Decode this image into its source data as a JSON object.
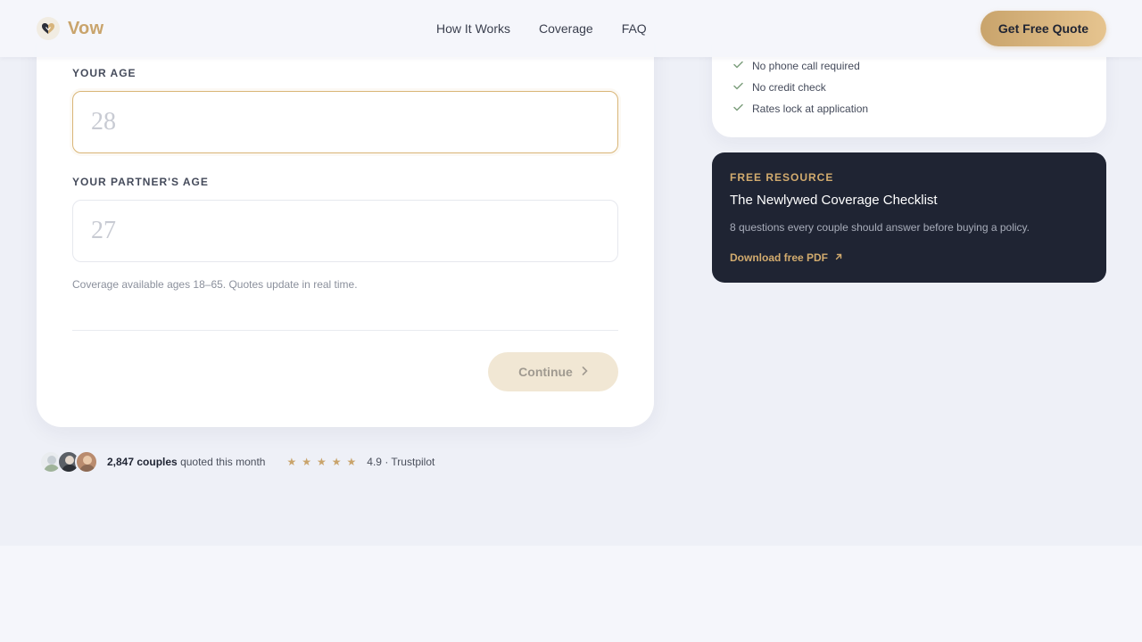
{
  "brand": {
    "name": "Vow",
    "accent": "#c9a46c"
  },
  "nav": {
    "items": [
      "How It Works",
      "Coverage",
      "FAQ"
    ],
    "cta": "Get Free Quote"
  },
  "form": {
    "age_label": "YOUR AGE",
    "age_placeholder": "28",
    "partner_label": "YOUR PARTNER'S AGE",
    "partner_placeholder": "27",
    "help": "Coverage available ages 18–65. Quotes update in real time.",
    "continue_label": "Continue"
  },
  "proof": {
    "count": "2,847 couples",
    "suffix": "quoted this month",
    "stars": 5,
    "rating": "4.9 · Trustpilot"
  },
  "benefits": [
    "No phone call required",
    "No credit check",
    "Rates lock at application"
  ],
  "resource": {
    "eyebrow": "FREE RESOURCE",
    "title": "The Newlywed Coverage Checklist",
    "description": "8 questions every couple should answer before buying a policy.",
    "link": "Download free PDF"
  },
  "icons": {
    "logo": "heart-icon",
    "check": "check-icon",
    "chevron": "chevron-right-icon",
    "arrow": "arrow-up-right-icon",
    "star": "star-icon"
  }
}
